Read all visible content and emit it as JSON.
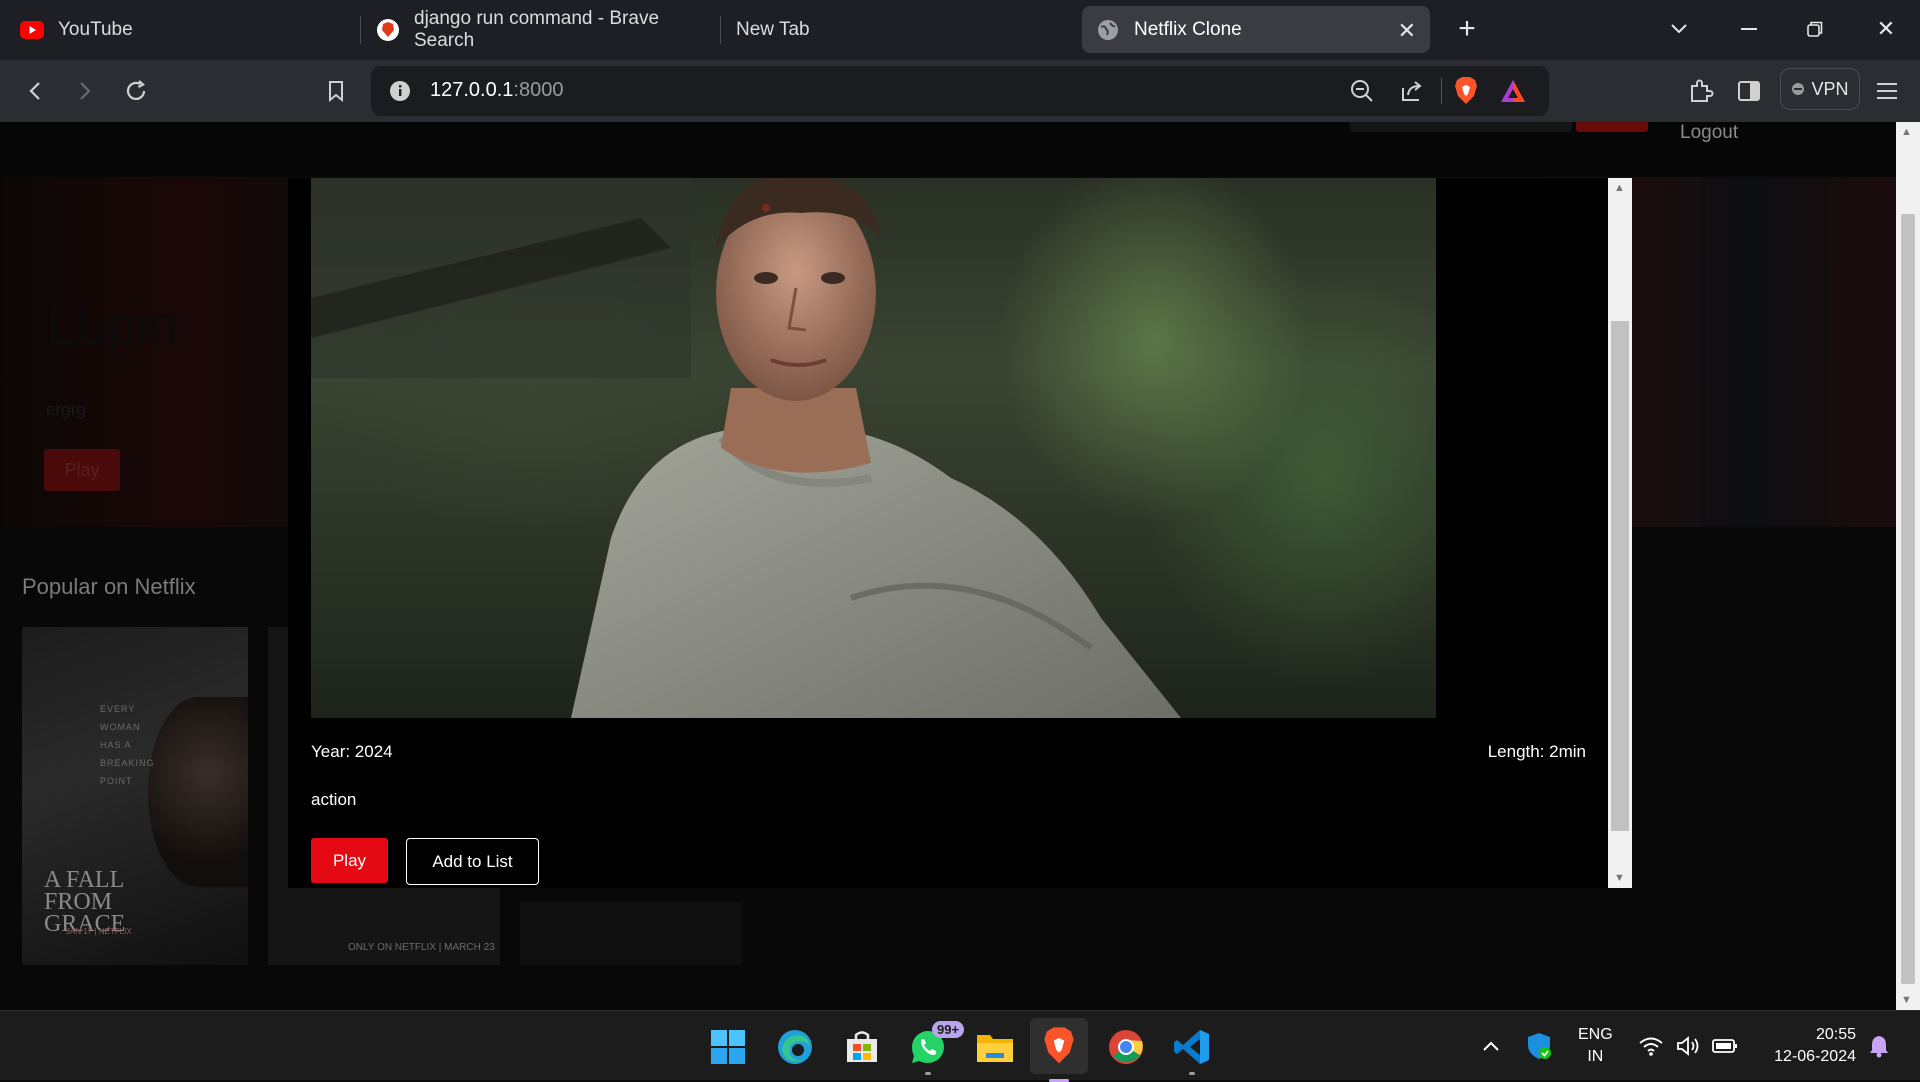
{
  "browser": {
    "tabs": [
      {
        "title": "YouTube",
        "icon": "youtube-icon",
        "active": false
      },
      {
        "title": "django run command - Brave Search",
        "icon": "brave-icon",
        "active": false
      },
      {
        "title": "New Tab",
        "icon": "",
        "active": false
      },
      {
        "title": "Netflix Clone",
        "icon": "globe-icon",
        "active": true
      }
    ],
    "url_host": "127.0.0.1",
    "url_port": ":8000",
    "vpn_label": "VPN"
  },
  "page": {
    "nav": {
      "logout_label": "Logout"
    },
    "hero": {
      "title": "Lupin",
      "description": "ergrg",
      "play_label": "Play"
    },
    "row_title": "Popular on Netflix",
    "posters": [
      {
        "tagline": "EVERY\nWOMAN\nHAS A\nBREAKING\nPOINT",
        "title": "A FALL FROM GRACE",
        "date": "JAN 17 | NETFLIX"
      },
      {
        "footer": "ONLY ON NETFLIX | MARCH 23"
      }
    ]
  },
  "modal": {
    "year": "Year: 2024",
    "length": "Length: 2min",
    "genre": "action",
    "play_label": "Play",
    "add_label": "Add to List"
  },
  "taskbar": {
    "apps": [
      "windows-start-icon",
      "edge-icon",
      "ms-store-icon",
      "whatsapp-icon",
      "file-explorer-icon",
      "brave-icon",
      "chrome-icon",
      "vscode-icon"
    ],
    "whatsapp_badge": "99+",
    "lang_top": "ENG",
    "lang_bottom": "IN",
    "time": "20:55",
    "date": "12-06-2024"
  },
  "colors": {
    "netflix_red": "#e50914",
    "brave_orange": "#fb542b"
  }
}
